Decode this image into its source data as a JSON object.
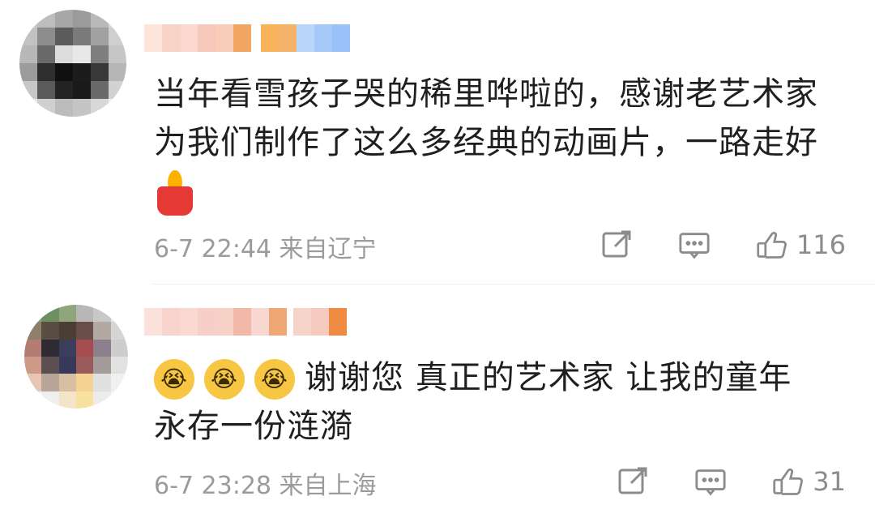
{
  "comments": [
    {
      "text_lines": [
        "当年看雪孩子哭的稀里哗啦的，感谢老艺术家",
        "为我们制作了这么多经典的动画片，一路走好"
      ],
      "meta": "6-7 22:44 来自辽宁",
      "likes": "116",
      "icons": [
        "candle-emoji",
        "share-icon",
        "comment-icon",
        "like-icon"
      ]
    },
    {
      "text_lines": [
        "谢谢您 真正的艺术家 让我的童年",
        "永存一份涟漪"
      ],
      "meta": "6-7 23:28 来自上海",
      "likes": "31",
      "icons": [
        "crying-emoji",
        "share-icon",
        "comment-icon",
        "like-icon"
      ]
    }
  ],
  "colors": {
    "text": "#1f1f1f",
    "meta": "#9b9b9b",
    "icon": "#8c8c8c",
    "divider": "#ececec"
  }
}
